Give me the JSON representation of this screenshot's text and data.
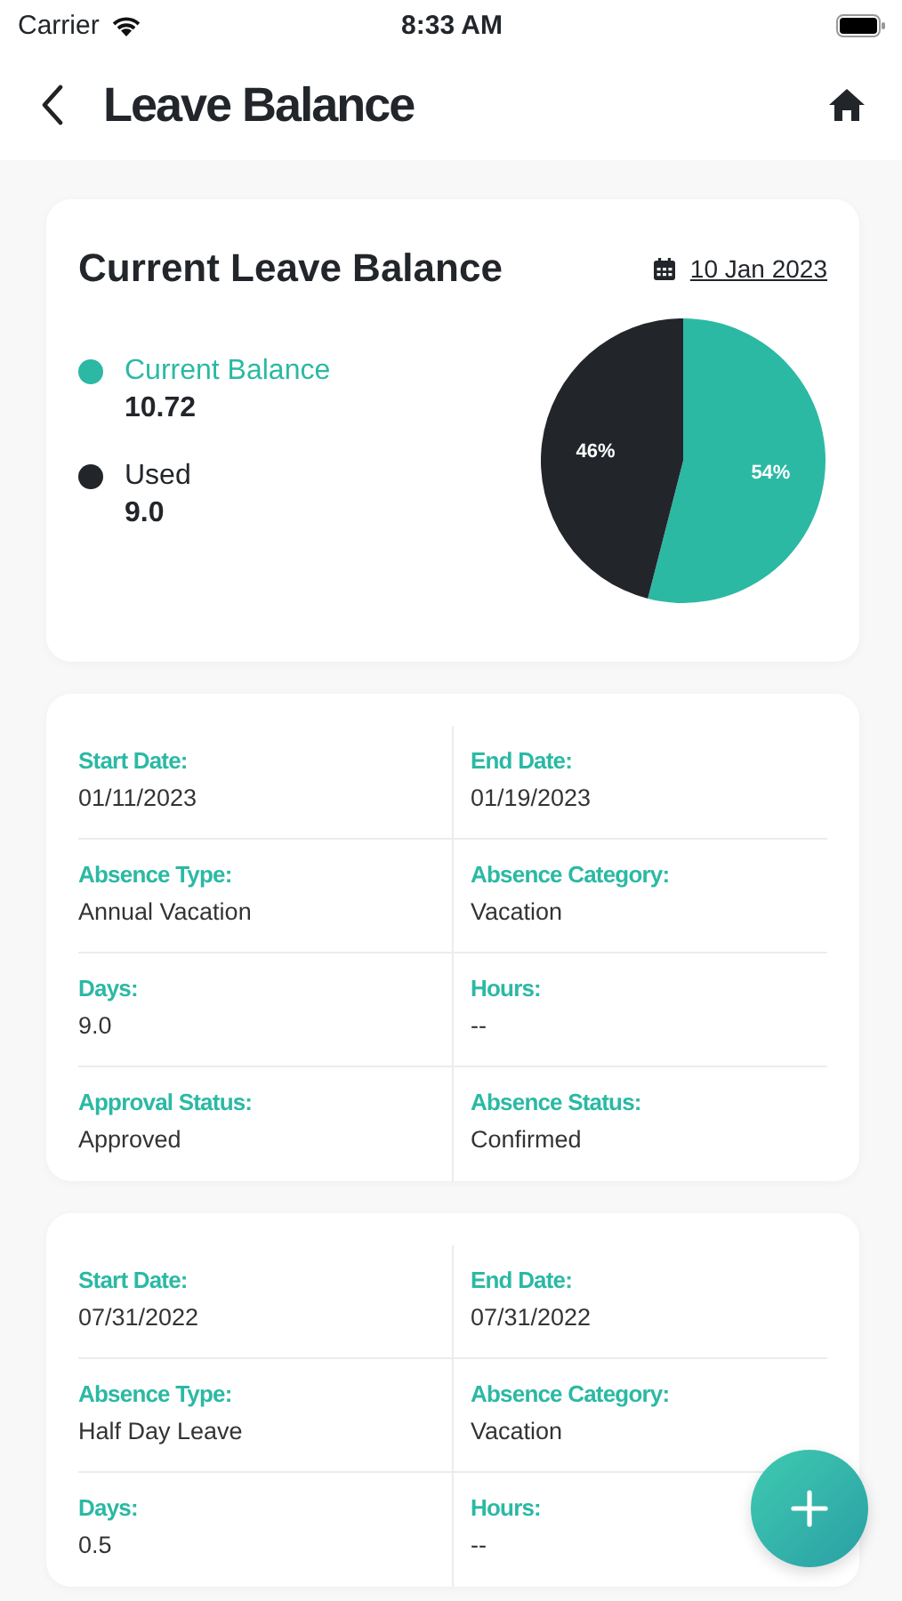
{
  "status_bar": {
    "carrier": "Carrier",
    "time": "8:33 AM"
  },
  "header": {
    "title": "Leave Balance"
  },
  "balance_card": {
    "title": "Current Leave Balance",
    "date": "10 Jan 2023",
    "legend": [
      {
        "label": "Current Balance",
        "value": "10.72",
        "color": "#2bb9a4"
      },
      {
        "label": "Used",
        "value": "9.0",
        "color": "#22262b"
      }
    ],
    "chart_data": {
      "type": "pie",
      "values": [
        54,
        46
      ],
      "colors": [
        "#2bb9a4",
        "#22262b"
      ],
      "value_labels": [
        "54%",
        "46%"
      ]
    }
  },
  "leave_records": [
    {
      "fields": [
        {
          "label": "Start Date:",
          "value": "01/11/2023"
        },
        {
          "label": "End Date:",
          "value": "01/19/2023"
        },
        {
          "label": "Absence Type:",
          "value": "Annual Vacation"
        },
        {
          "label": "Absence Category:",
          "value": "Vacation"
        },
        {
          "label": "Days:",
          "value": "9.0"
        },
        {
          "label": "Hours:",
          "value": "--"
        },
        {
          "label": "Approval Status:",
          "value": "Approved"
        },
        {
          "label": "Absence Status:",
          "value": "Confirmed"
        }
      ]
    },
    {
      "fields": [
        {
          "label": "Start Date:",
          "value": "07/31/2022"
        },
        {
          "label": "End Date:",
          "value": "07/31/2022"
        },
        {
          "label": "Absence Type:",
          "value": "Half Day Leave"
        },
        {
          "label": "Absence Category:",
          "value": "Vacation"
        },
        {
          "label": "Days:",
          "value": "0.5"
        },
        {
          "label": "Hours:",
          "value": "--"
        }
      ]
    }
  ]
}
